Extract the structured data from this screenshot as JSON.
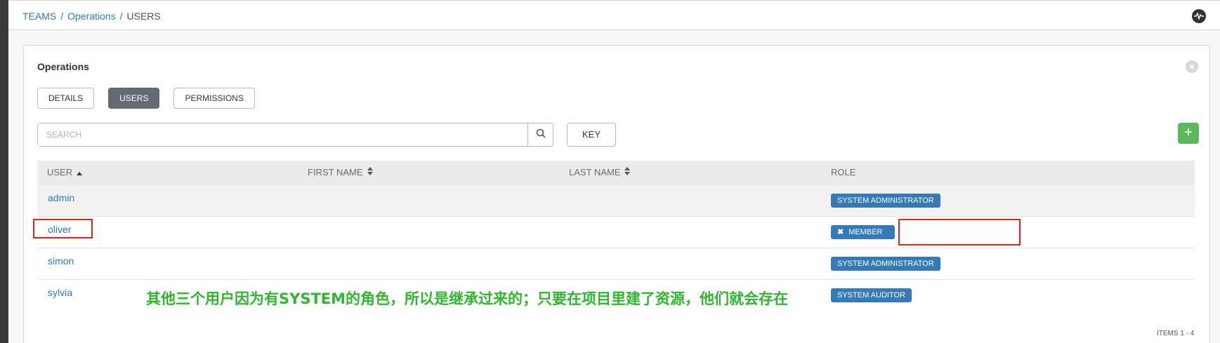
{
  "breadcrumb": {
    "teams": "TEAMS",
    "team": "Operations",
    "current": "USERS",
    "sep": "/"
  },
  "panel": {
    "title": "Operations"
  },
  "tabs": [
    {
      "label": "DETAILS",
      "active": false
    },
    {
      "label": "USERS",
      "active": true
    },
    {
      "label": "PERMISSIONS",
      "active": false
    }
  ],
  "search": {
    "placeholder": "SEARCH",
    "value": ""
  },
  "key_label": "KEY",
  "add_label": "+",
  "table": {
    "columns": [
      "USER",
      "FIRST NAME",
      "LAST NAME",
      "ROLE"
    ],
    "rows": [
      {
        "user": "admin",
        "first": "",
        "last": "",
        "role": "SYSTEM ADMINISTRATOR",
        "removable": false
      },
      {
        "user": "oliver",
        "first": "",
        "last": "",
        "role": "MEMBER",
        "removable": true
      },
      {
        "user": "simon",
        "first": "",
        "last": "",
        "role": "SYSTEM ADMINISTRATOR",
        "removable": false
      },
      {
        "user": "sylvia",
        "first": "",
        "last": "",
        "role": "SYSTEM AUDITOR",
        "removable": false
      }
    ]
  },
  "annotation": "其他三个用户因为有SYSTEM的角色，所以是继承过来的；只要在项目里建了资源，他们就会存在",
  "items": "ITEMS  1 - 4",
  "colors": {
    "accent": "#337ab7",
    "add": "#5cb85c",
    "highlight": "#e02020",
    "annotation": "#2fb52f",
    "active_tab": "#646972"
  }
}
